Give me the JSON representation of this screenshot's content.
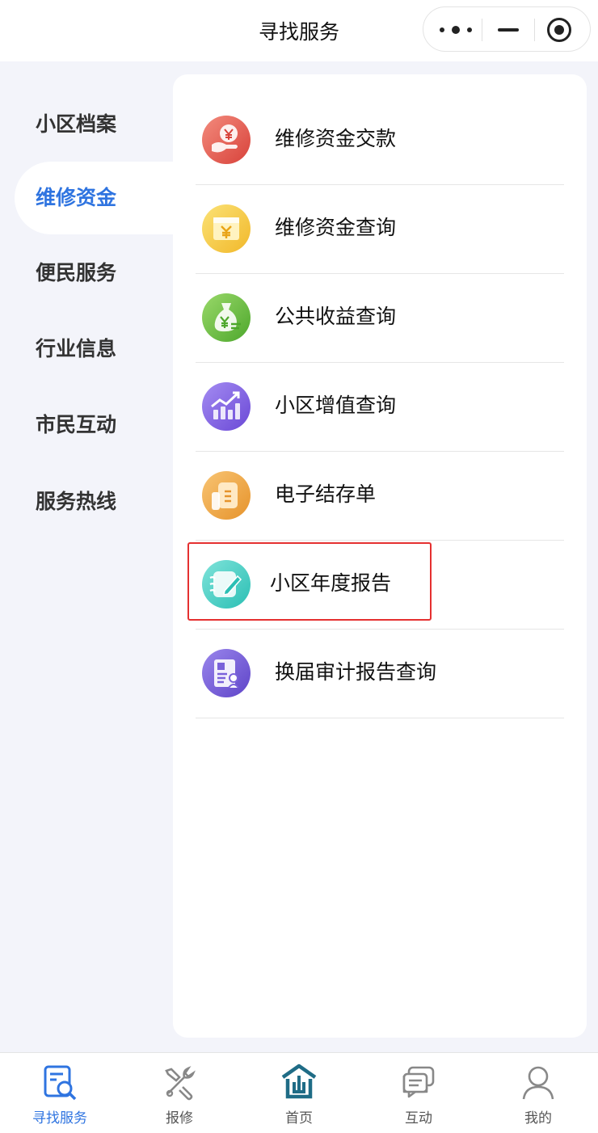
{
  "header": {
    "title": "寻找服务"
  },
  "sidebar": {
    "items": [
      {
        "label": "小区档案"
      },
      {
        "label": "维修资金"
      },
      {
        "label": "便民服务"
      },
      {
        "label": "行业信息"
      },
      {
        "label": "市民互动"
      },
      {
        "label": "服务热线"
      }
    ],
    "active_index": 1
  },
  "services": [
    {
      "label": "维修资金交款",
      "icon": "repair-fund-payment-icon"
    },
    {
      "label": "维修资金查询",
      "icon": "repair-fund-query-icon"
    },
    {
      "label": "公共收益查询",
      "icon": "public-income-query-icon"
    },
    {
      "label": "小区增值查询",
      "icon": "community-appreciation-icon"
    },
    {
      "label": "电子结存单",
      "icon": "electronic-statement-icon"
    },
    {
      "label": "小区年度报告",
      "icon": "annual-report-icon"
    },
    {
      "label": "换届审计报告查询",
      "icon": "audit-report-icon"
    }
  ],
  "tabbar": {
    "items": [
      {
        "label": "寻找服务",
        "icon": "search-service-icon"
      },
      {
        "label": "报修",
        "icon": "repair-tools-icon"
      },
      {
        "label": "首页",
        "icon": "home-logo-icon"
      },
      {
        "label": "互动",
        "icon": "chat-icon"
      },
      {
        "label": "我的",
        "icon": "user-icon"
      }
    ],
    "active_index": 0
  },
  "colors": {
    "accent": "#2f74e0",
    "highlight_border": "#e53030",
    "page_bg": "#f3f4fa"
  }
}
